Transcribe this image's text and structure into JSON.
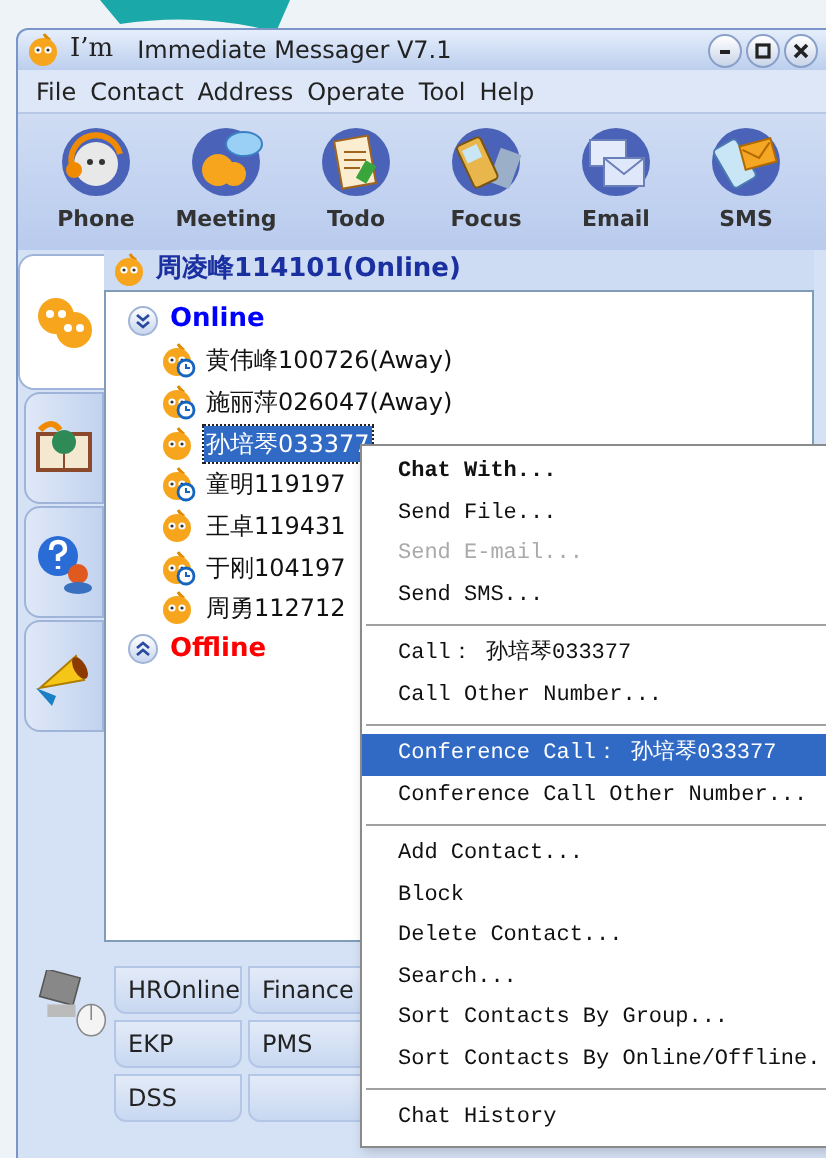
{
  "window": {
    "logo": "I’m",
    "title": "Immediate Messager V7.1"
  },
  "menu_bar": [
    {
      "label": "File"
    },
    {
      "label": "Contact"
    },
    {
      "label": "Address"
    },
    {
      "label": "Operate"
    },
    {
      "label": "Tool"
    },
    {
      "label": "Help"
    }
  ],
  "toolbar": [
    {
      "label": "Phone"
    },
    {
      "label": "Meeting"
    },
    {
      "label": "Todo"
    },
    {
      "label": "Focus"
    },
    {
      "label": "Email"
    },
    {
      "label": "SMS"
    }
  ],
  "side_tabs": [
    {
      "selected": true
    },
    {
      "selected": false
    },
    {
      "selected": false
    },
    {
      "selected": false
    }
  ],
  "user": {
    "name": "周凌峰114101(Online)"
  },
  "groups": [
    {
      "label": "Online",
      "expanded": true,
      "color": "#0000ff",
      "children": [
        {
          "name": "黄伟峰100726(Away)",
          "away": true,
          "selected": false
        },
        {
          "name": "施丽萍026047(Away)",
          "away": true,
          "selected": false
        },
        {
          "name": "孙培琴033377",
          "away": false,
          "selected": true
        },
        {
          "name": "童明119197",
          "away": true,
          "selected": false
        },
        {
          "name": "王卓119431",
          "away": false,
          "selected": false
        },
        {
          "name": "于刚104197",
          "away": true,
          "selected": false
        },
        {
          "name": "周勇112712",
          "away": false,
          "selected": false
        }
      ]
    },
    {
      "label": "Offline",
      "expanded": false,
      "color": "#ff0000"
    }
  ],
  "app_buttons": [
    {
      "kind": "app",
      "label": "HROnline"
    },
    {
      "kind": "app",
      "label": "Finance"
    },
    {
      "kind": "app",
      "label": "EKP"
    },
    {
      "kind": "app",
      "label": "PMS"
    },
    {
      "kind": "app",
      "label": "DSS"
    },
    {
      "kind": "blank"
    }
  ],
  "context_menu": [
    {
      "kind": "item",
      "label": "Chat With...",
      "bold": true,
      "disabled": false,
      "selected": false
    },
    {
      "kind": "item",
      "label": "Send File...",
      "bold": false,
      "disabled": false,
      "selected": false
    },
    {
      "kind": "item",
      "label": "Send E-mail...",
      "bold": false,
      "disabled": true,
      "selected": false
    },
    {
      "kind": "item",
      "label": "Send SMS...",
      "bold": false,
      "disabled": false,
      "selected": false
    },
    {
      "kind": "separator"
    },
    {
      "kind": "item",
      "label": "Call： 孙培琴033377",
      "bold": false,
      "disabled": false,
      "selected": false
    },
    {
      "kind": "item",
      "label": "Call Other Number...",
      "bold": false,
      "disabled": false,
      "selected": false
    },
    {
      "kind": "separator"
    },
    {
      "kind": "item",
      "label": "Conference Call： 孙培琴033377",
      "bold": false,
      "disabled": false,
      "selected": true
    },
    {
      "kind": "item",
      "label": "Conference Call Other Number...",
      "bold": false,
      "disabled": false,
      "selected": false
    },
    {
      "kind": "separator"
    },
    {
      "kind": "item",
      "label": "Add Contact...",
      "bold": false,
      "disabled": false,
      "selected": false
    },
    {
      "kind": "item",
      "label": "Block",
      "bold": false,
      "disabled": false,
      "selected": false
    },
    {
      "kind": "item",
      "label": "Delete Contact...",
      "bold": false,
      "disabled": false,
      "selected": false
    },
    {
      "kind": "item",
      "label": "Search...",
      "bold": false,
      "disabled": false,
      "selected": false
    },
    {
      "kind": "item",
      "label": "Sort Contacts By Group...",
      "bold": false,
      "disabled": false,
      "selected": false
    },
    {
      "kind": "item",
      "label": "Sort Contacts By Online/Offline.",
      "bold": false,
      "disabled": false,
      "selected": false
    },
    {
      "kind": "separator"
    },
    {
      "kind": "item",
      "label": "Chat History",
      "bold": false,
      "disabled": false,
      "selected": false
    }
  ]
}
